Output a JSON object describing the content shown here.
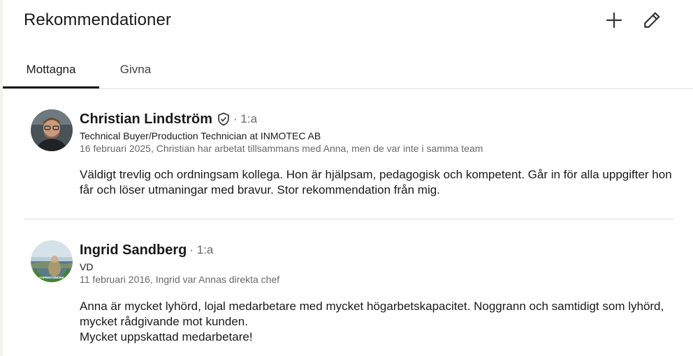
{
  "header": {
    "title": "Rekommendationer",
    "add_icon": "plus-icon",
    "edit_icon": "pencil-icon"
  },
  "tabs": [
    {
      "label": "Mottagna",
      "active": true
    },
    {
      "label": "Givna",
      "active": false
    }
  ],
  "recommendations": [
    {
      "name": "Christian Lindström",
      "verified": true,
      "degree": "· 1:a",
      "headline": "Technical Buyer/Production Technician at INMOTEC AB",
      "meta": "16 februari 2025, Christian har arbetat tillsammans med Anna, men de var inte i samma team",
      "text": "Väldigt trevlig och ordningsam kollega. Hon är hjälpsam, pedagogisk och kompetent. Går in för alla uppgifter hon får och löser utmaningar med bravur. Stor rekommendation från mig."
    },
    {
      "name": "Ingrid Sandberg",
      "verified": false,
      "degree": "· 1:a",
      "headline": "VD",
      "meta": "11 februari 2016, Ingrid var Annas direkta chef",
      "text": "Anna är mycket lyhörd, lojal medarbetare med mycket högarbetskapacitet. Noggrann och samtidigt som lyhörd, mycket rådgivande mot kunden.\nMycket uppskattad medarbetare!",
      "avatar_frame_text": "#OPENTOWORK"
    }
  ],
  "colors": {
    "text_primary": "#191919",
    "text_secondary": "#666666",
    "divider": "#e0dfdc",
    "opentowork_green": "#428530"
  }
}
